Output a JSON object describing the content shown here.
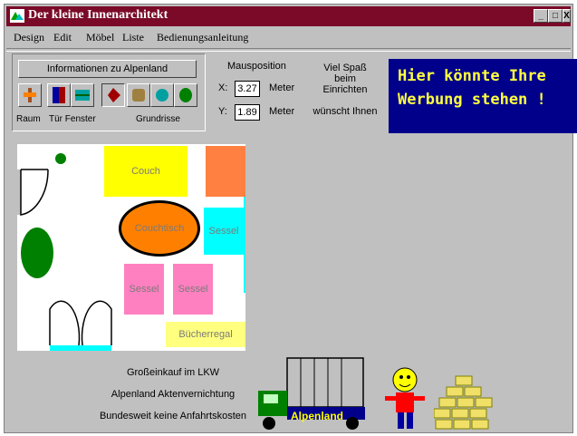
{
  "window": {
    "title": "Der kleine Innenarchitekt",
    "controls": [
      "_",
      "□",
      "X"
    ]
  },
  "menu": [
    "Design",
    "Edit",
    "Möbel",
    "Liste",
    "Bedienungsanleitung"
  ],
  "toolbar": {
    "info_button": "Informationen zu Alpenland",
    "groups": {
      "room": "Raum",
      "door_window": "Tür Fenster",
      "floor_plan": "Grundrisse"
    }
  },
  "mouse": {
    "title": "Mausposition",
    "x_label": "X:",
    "x_value": "3.27",
    "y_label": "Y:",
    "y_value": "1.89",
    "unit": "Meter"
  },
  "fun_text": {
    "line1": "Viel Spaß beim",
    "line2": "Einrichten",
    "line3": "wünscht Ihnen"
  },
  "ad": {
    "line1": "Hier könnte Ihre",
    "line2": "Werbung stehen !"
  },
  "furniture": {
    "couch": "Couch",
    "table": "Couchtisch",
    "chair_right": "Sessel",
    "chair_1": "Sessel",
    "chair_2": "Sessel",
    "shelf": "Bücherregal"
  },
  "promo": {
    "line1": "Großeinkauf im LKW",
    "line2": "Alpenland Aktenvernichtung",
    "line3": "Bundesweit keine Anfahrtskosten",
    "truck_label": "Alpenland"
  },
  "colors": {
    "title_bar": "#7a0a28",
    "ad_bg": "#00008b",
    "ad_text": "#ffff40",
    "couch": "#ffff00",
    "table": "#ff8000",
    "chair_cyan": "#00ffff",
    "chair_pink": "#ff80c0",
    "plant": "#008000",
    "corner": "#ff8040"
  }
}
